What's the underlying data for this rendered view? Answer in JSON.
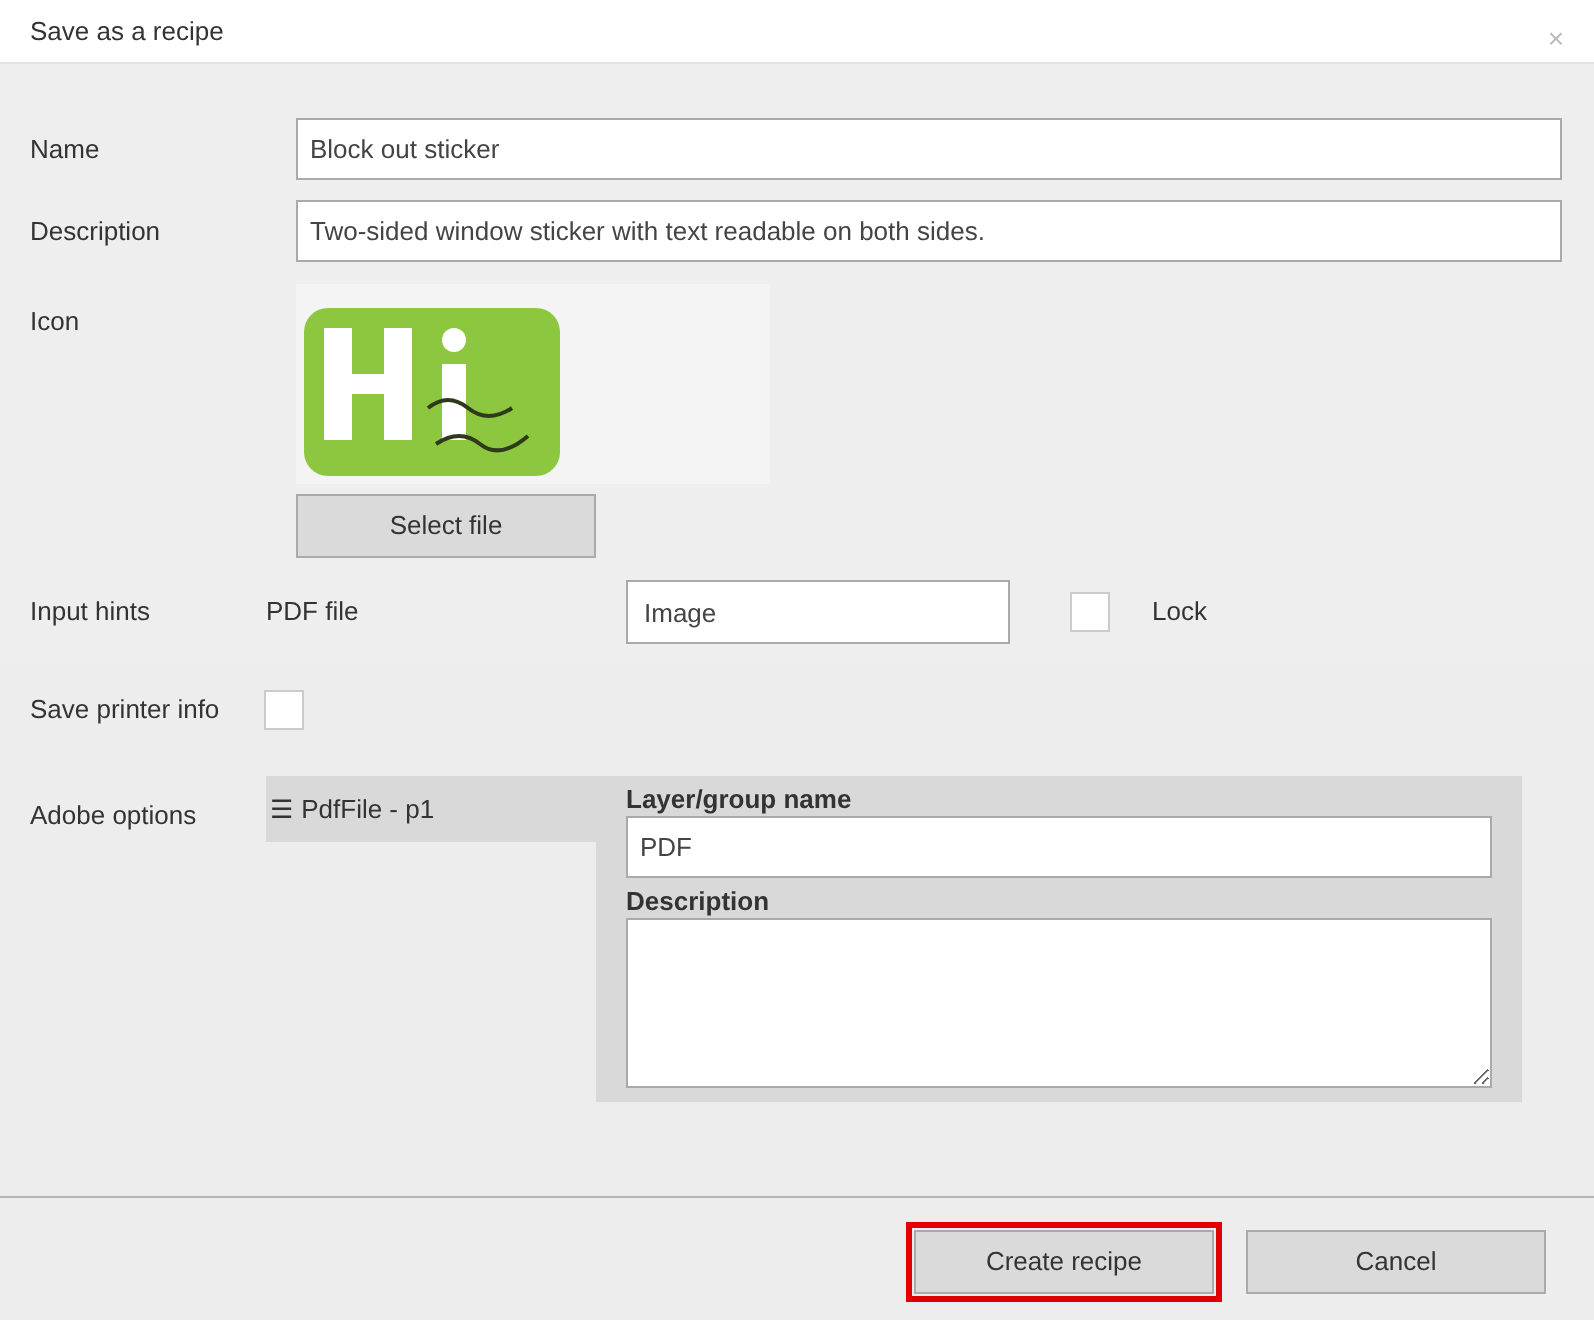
{
  "window": {
    "title": "Save as a recipe",
    "close": "×"
  },
  "fields": [
    {
      "label": "Name",
      "value": "Block out sticker"
    },
    {
      "label": "Description",
      "value": "Two-sided window sticker with text readable on both sides."
    }
  ],
  "icon": {
    "label": "Icon",
    "button": "Select file"
  },
  "input_hints": {
    "label": "Input hints",
    "pdf_label": "PDF file",
    "image_value": "Image",
    "lock": {
      "label": "Lock",
      "checked": false
    }
  },
  "save_printer_info": {
    "label": "Save printer info",
    "checked": false
  },
  "adobe_options": {
    "label": "Adobe options",
    "layers": [
      {
        "icon": "☰",
        "label": "PdfFile - p1",
        "selected": true
      }
    ],
    "layer_name": {
      "label": "Layer/group name",
      "value": "PDF"
    },
    "description": {
      "label": "Description"
    }
  },
  "buttons": [
    {
      "label": "Create recipe",
      "highlighted": true
    },
    {
      "label": "Cancel",
      "highlighted": false
    }
  ]
}
